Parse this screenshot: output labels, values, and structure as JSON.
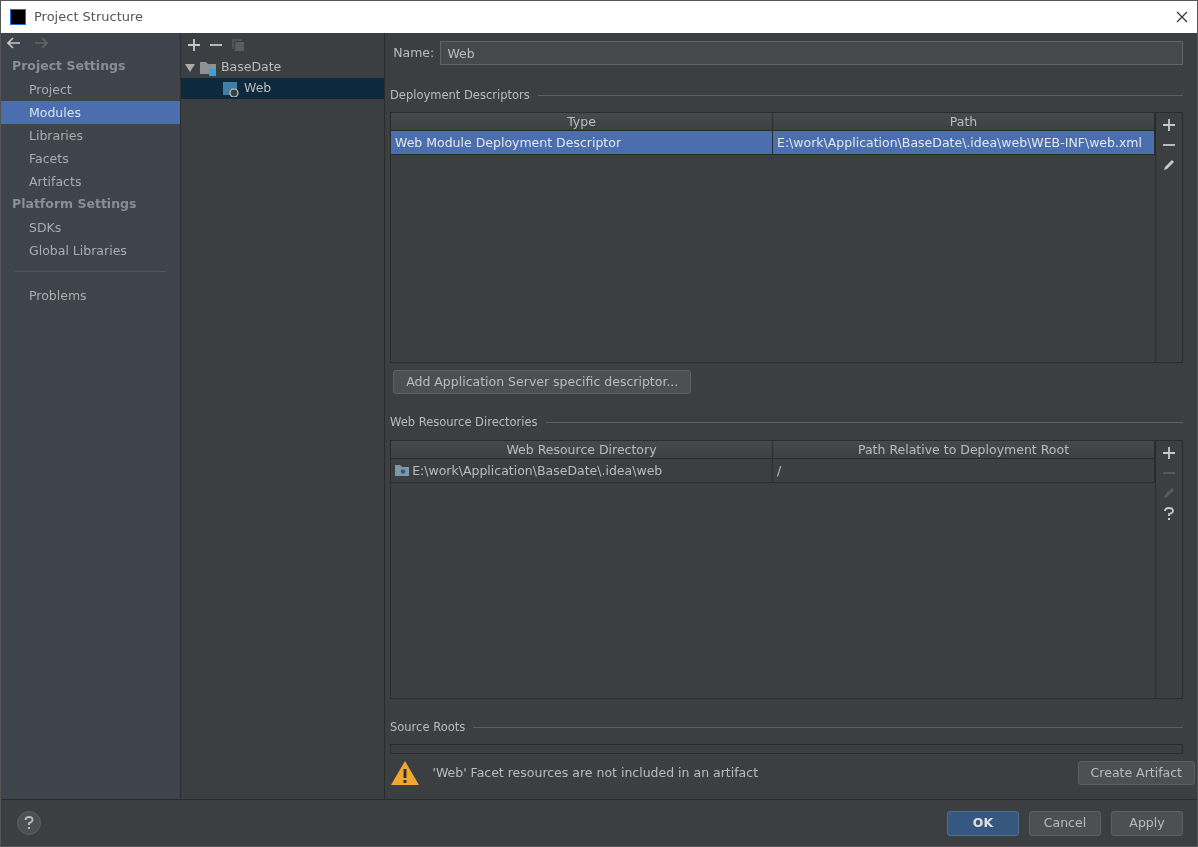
{
  "window": {
    "title": "Project Structure"
  },
  "sidebar": {
    "sections": [
      {
        "heading": "Project Settings",
        "items": [
          {
            "label": "Project",
            "selected": false
          },
          {
            "label": "Modules",
            "selected": true
          },
          {
            "label": "Libraries",
            "selected": false
          },
          {
            "label": "Facets",
            "selected": false
          },
          {
            "label": "Artifacts",
            "selected": false
          }
        ]
      },
      {
        "heading": "Platform Settings",
        "items": [
          {
            "label": "SDKs",
            "selected": false
          },
          {
            "label": "Global Libraries",
            "selected": false
          }
        ]
      }
    ],
    "footer_items": [
      {
        "label": "Problems",
        "selected": false
      }
    ]
  },
  "tree": {
    "nodes": [
      {
        "label": "BaseDate",
        "expanded": true,
        "selected": false,
        "children": [
          {
            "label": "Web",
            "selected": true
          }
        ]
      }
    ]
  },
  "name_field": {
    "label": "Name:",
    "value": "Web"
  },
  "deployment_descriptors": {
    "title": "Deployment Descriptors",
    "columns": [
      "Type",
      "Path"
    ],
    "rows": [
      {
        "cells": [
          "Web Module Deployment Descriptor",
          "E:\\work\\Application\\BaseDate\\.idea\\web\\WEB-INF\\web.xml"
        ],
        "selected": true
      }
    ],
    "tools": [
      {
        "kind": "add",
        "disabled": false
      },
      {
        "kind": "remove",
        "disabled": false
      },
      {
        "kind": "edit",
        "disabled": false
      }
    ]
  },
  "add_descriptor_button": "Add Application Server specific descriptor...",
  "web_resource_directories": {
    "title": "Web Resource Directories",
    "columns": [
      "Web Resource Directory",
      "Path Relative to Deployment Root"
    ],
    "rows": [
      {
        "cells": [
          "E:\\work\\Application\\BaseDate\\.idea\\web",
          "/"
        ],
        "selected": false
      }
    ],
    "tools": [
      {
        "kind": "add",
        "disabled": false
      },
      {
        "kind": "remove",
        "disabled": true
      },
      {
        "kind": "edit",
        "disabled": true
      },
      {
        "kind": "help",
        "disabled": false
      }
    ]
  },
  "source_roots": {
    "title": "Source Roots"
  },
  "warning": {
    "text": "'Web' Facet resources are not included in an artifact",
    "button": "Create Artifact"
  },
  "buttons": [
    {
      "label": "OK",
      "kind": "primary"
    },
    {
      "label": "Cancel",
      "kind": "default"
    },
    {
      "label": "Apply",
      "kind": "default"
    }
  ]
}
